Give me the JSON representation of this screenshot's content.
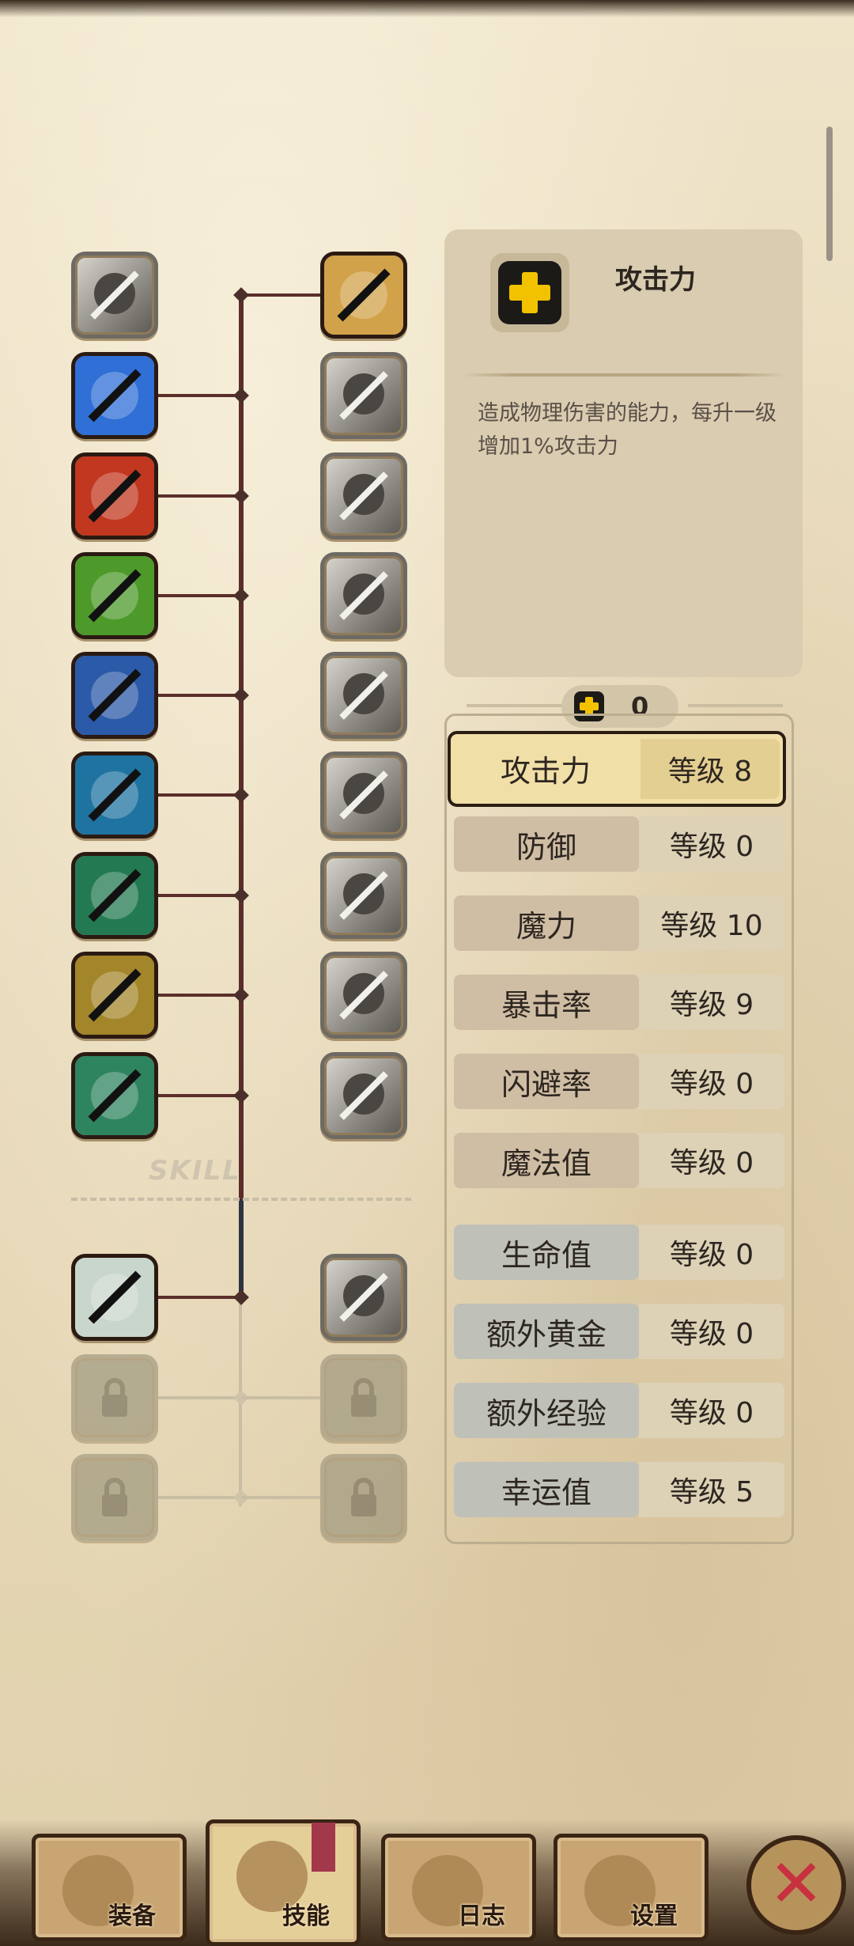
{
  "skill_tree": {
    "label": "SKILL",
    "left_column": [
      {
        "name": "slash-skill-icon",
        "state": "gray"
      },
      {
        "name": "blue-blade-skill-icon",
        "state": "active",
        "color": "#2f6fd6"
      },
      {
        "name": "rage-skill-icon",
        "state": "active",
        "color": "#c2371f"
      },
      {
        "name": "muscle-skill-icon",
        "state": "active",
        "color": "#4d9a2a"
      },
      {
        "name": "dark-spirit-skill-icon",
        "state": "active",
        "color": "#2b5aa8"
      },
      {
        "name": "dagger-skill-icon",
        "state": "active",
        "color": "#1f73a0"
      },
      {
        "name": "dash-skill-icon",
        "state": "active",
        "color": "#237a52"
      },
      {
        "name": "golden-hero-skill-icon",
        "state": "active",
        "color": "#a3862a"
      },
      {
        "name": "sword-skill-icon",
        "state": "active",
        "color": "#2f8460"
      },
      {
        "name": "armor-skill-icon",
        "state": "active",
        "color": "#c9d6cb"
      },
      {
        "name": "locked-skill-icon",
        "state": "locked"
      },
      {
        "name": "locked-skill-icon",
        "state": "locked"
      }
    ],
    "right_column": [
      {
        "name": "shield-skill-icon",
        "state": "active",
        "color": "#d2a24a"
      },
      {
        "name": "strike-skill-icon",
        "state": "gray"
      },
      {
        "name": "lightning-skill-icon",
        "state": "gray"
      },
      {
        "name": "charge-skill-icon",
        "state": "gray"
      },
      {
        "name": "burst-skill-icon",
        "state": "gray"
      },
      {
        "name": "eye-skill-icon",
        "state": "gray"
      },
      {
        "name": "leap-skill-icon",
        "state": "gray"
      },
      {
        "name": "explosion-skill-icon",
        "state": "gray"
      },
      {
        "name": "heal-skill-icon",
        "state": "gray"
      },
      {
        "name": "vision-armor-skill-icon",
        "state": "gray"
      },
      {
        "name": "locked-skill-icon",
        "state": "locked"
      },
      {
        "name": "locked-skill-icon",
        "state": "locked"
      }
    ]
  },
  "info": {
    "icon": "plus-icon",
    "title": "攻击力",
    "description": "造成物理伤害的能力，每升一级增加1%攻击力"
  },
  "points": {
    "icon": "plus-icon",
    "value": "0"
  },
  "stats": [
    {
      "name": "攻击力",
      "level": "等级 8",
      "style": "selected"
    },
    {
      "name": "防御",
      "level": "等级 0",
      "style": "tan"
    },
    {
      "name": "魔力",
      "level": "等级 10",
      "style": "tan"
    },
    {
      "name": "暴击率",
      "level": "等级 9",
      "style": "tan"
    },
    {
      "name": "闪避率",
      "level": "等级 0",
      "style": "tan"
    },
    {
      "name": "魔法值",
      "level": "等级 0",
      "style": "tan"
    },
    {
      "name": "生命值",
      "level": "等级 0",
      "style": "gray"
    },
    {
      "name": "额外黄金",
      "level": "等级 0",
      "style": "gray"
    },
    {
      "name": "额外经验",
      "level": "等级 0",
      "style": "gray"
    },
    {
      "name": "幸运值",
      "level": "等级 5",
      "style": "gray"
    }
  ],
  "nav": {
    "tabs": [
      {
        "label": "装备",
        "icon": "axe-icon"
      },
      {
        "label": "技能",
        "icon": "skill-icon",
        "active": true
      },
      {
        "label": "日志",
        "icon": "journal-icon"
      },
      {
        "label": "设置",
        "icon": "gear-icon"
      }
    ],
    "close_icon": "close-icon"
  },
  "colors": {
    "accent_plus": "#f2c200",
    "close": "#c8313f"
  }
}
